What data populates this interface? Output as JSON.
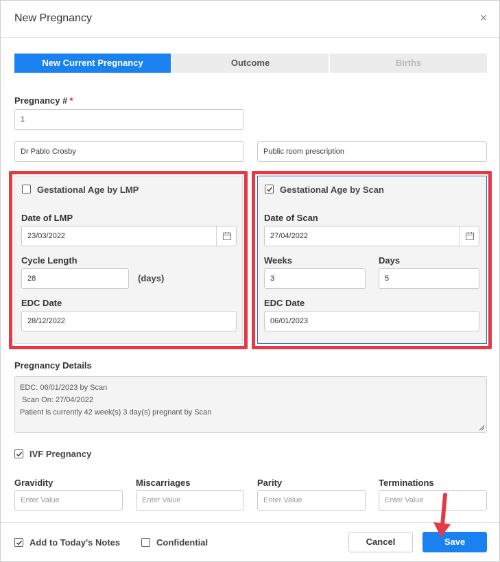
{
  "dialog": {
    "title": "New Pregnancy",
    "close_glyph": "×"
  },
  "tabs": [
    {
      "label": "New Current Pregnancy",
      "state": "active"
    },
    {
      "label": "Outcome",
      "state": "inactive"
    },
    {
      "label": "Births",
      "state": "disabled"
    }
  ],
  "pregnancy_number": {
    "label": "Pregnancy #",
    "required_mark": "*",
    "value": "1"
  },
  "doctor_field": {
    "value": "Dr Pablo Crosby"
  },
  "room_field": {
    "value": "Public room prescription"
  },
  "lmp_panel": {
    "checkbox_label": "Gestational Age by LMP",
    "checked": false,
    "date_label": "Date of LMP",
    "date_value": "23/03/2022",
    "cycle_label": "Cycle Length",
    "cycle_value": "28",
    "cycle_unit": "(days)",
    "edc_label": "EDC Date",
    "edc_value": "28/12/2022"
  },
  "scan_panel": {
    "checkbox_label": "Gestational Age by Scan",
    "checked": true,
    "date_label": "Date of Scan",
    "date_value": "27/04/2022",
    "weeks_label": "Weeks",
    "weeks_value": "3",
    "days_label": "Days",
    "days_value": "5",
    "edc_label": "EDC Date",
    "edc_value": "06/01/2023"
  },
  "details": {
    "label": "Pregnancy Details",
    "lines": [
      "EDC: 06/01/2023 by Scan",
      " Scan On: 27/04/2022",
      "Patient is currently 42 week(s) 3 day(s) pregnant by Scan"
    ]
  },
  "ivf": {
    "label": "IVF Pregnancy",
    "checked": true
  },
  "history": {
    "gravidity_label": "Gravidity",
    "miscarriages_label": "Miscarriages",
    "parity_label": "Parity",
    "terminations_label": "Terminations",
    "placeholder": "Enter Value"
  },
  "footer": {
    "add_notes_label": "Add to Today's Notes",
    "add_notes_checked": true,
    "confidential_label": "Confidential",
    "confidential_checked": false,
    "cancel_label": "Cancel",
    "save_label": "Save"
  },
  "colors": {
    "accent": "#1a82f0",
    "highlight": "#e53945",
    "required": "#e02d2d"
  }
}
